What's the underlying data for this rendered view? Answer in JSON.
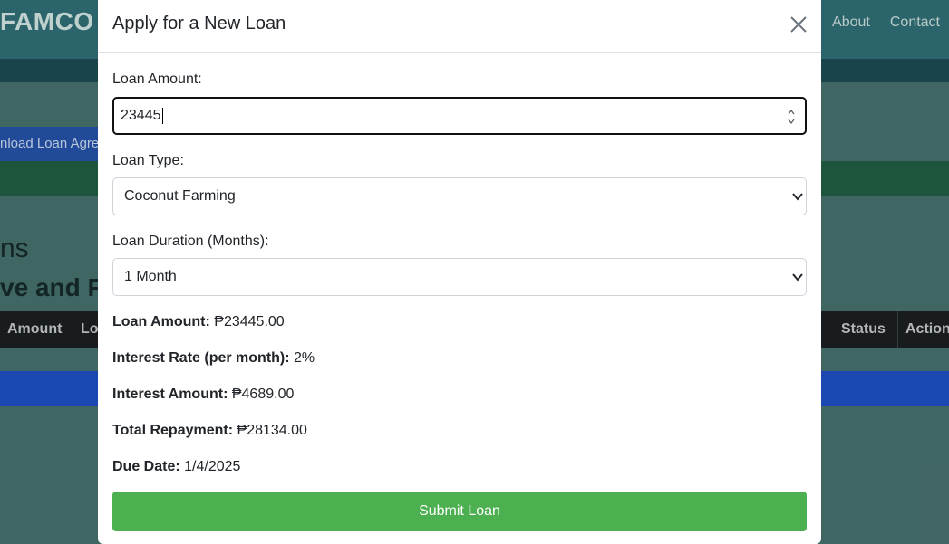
{
  "background": {
    "brand": "FAMCO",
    "nav": [
      "About",
      "Contact"
    ],
    "download_button": "nload Loan Agre",
    "heading_1": "ns",
    "heading_2": "ve and Pa",
    "table_headers": [
      "Amount",
      "Lo",
      "Status",
      "Action"
    ]
  },
  "modal": {
    "title": "Apply for a New Loan",
    "loan_amount_label": "Loan Amount:",
    "loan_amount_value": "23445",
    "loan_type_label": "Loan Type:",
    "loan_type_selected": "Coconut Farming",
    "duration_label": "Loan Duration (Months):",
    "duration_selected": "1 Month",
    "summary": [
      {
        "label": "Loan Amount:",
        "value": "₱23445.00"
      },
      {
        "label": "Interest Rate (per month):",
        "value": "2%"
      },
      {
        "label": "Interest Amount:",
        "value": "₱4689.00"
      },
      {
        "label": "Total Repayment:",
        "value": "₱28134.00"
      },
      {
        "label": "Due Date:",
        "value": "1/4/2025"
      }
    ],
    "submit_label": "Submit Loan"
  },
  "colors": {
    "submit": "#4caf50",
    "header_bg": "#2f6d73",
    "table_head": "#1b1f22",
    "download_btn": "#2451a6"
  }
}
